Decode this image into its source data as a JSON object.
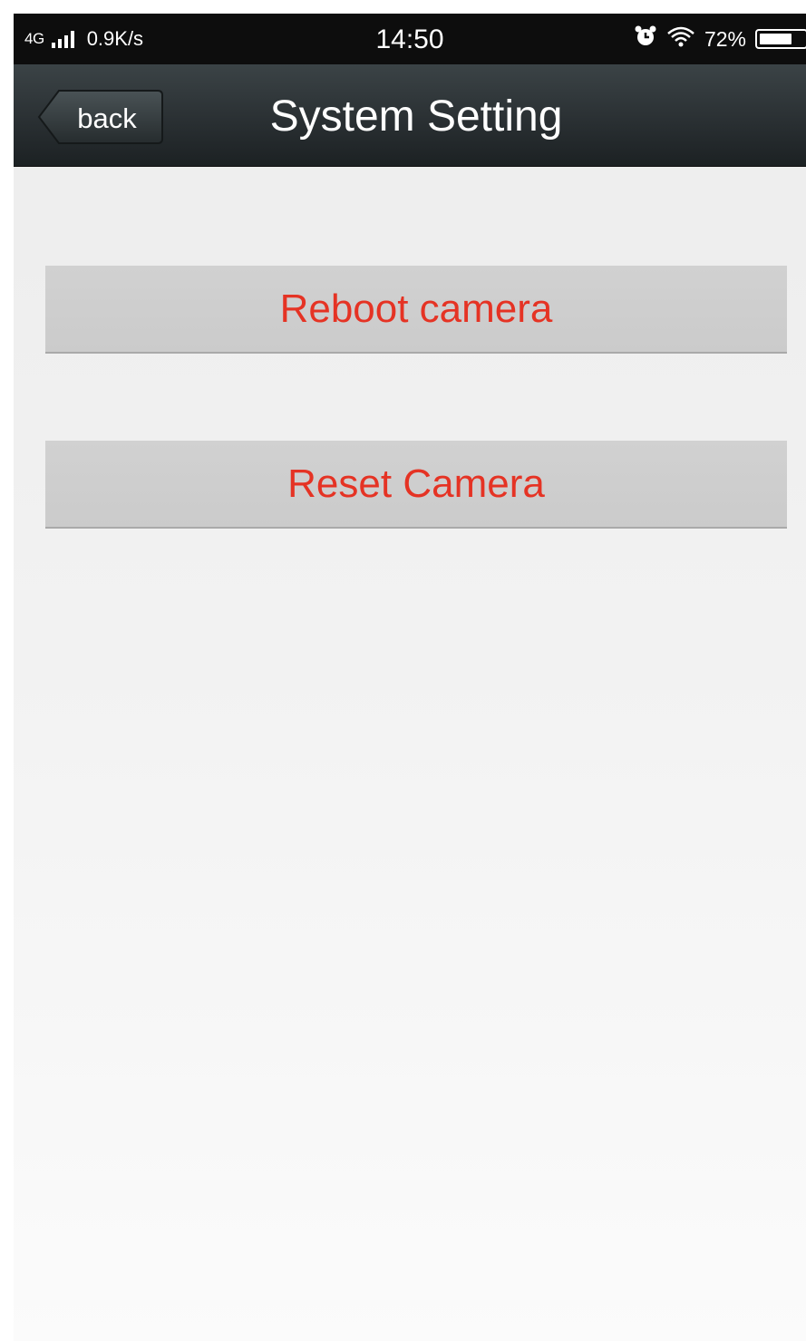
{
  "status_bar": {
    "network": "4G",
    "speed": "0.9K/s",
    "time": "14:50",
    "battery_text": "72%",
    "battery_level": 0.72,
    "icons": {
      "signal": "signal-bars-icon",
      "alarm": "alarm-clock-icon",
      "wifi": "wifi-icon",
      "battery": "battery-icon"
    }
  },
  "nav": {
    "back_label": "back",
    "title": "System Setting"
  },
  "actions": {
    "reboot_label": "Reboot camera",
    "reset_label": "Reset Camera"
  },
  "colors": {
    "action_text": "#e53324",
    "nav_background": "#2a3033",
    "status_background": "#0d0d0d"
  }
}
